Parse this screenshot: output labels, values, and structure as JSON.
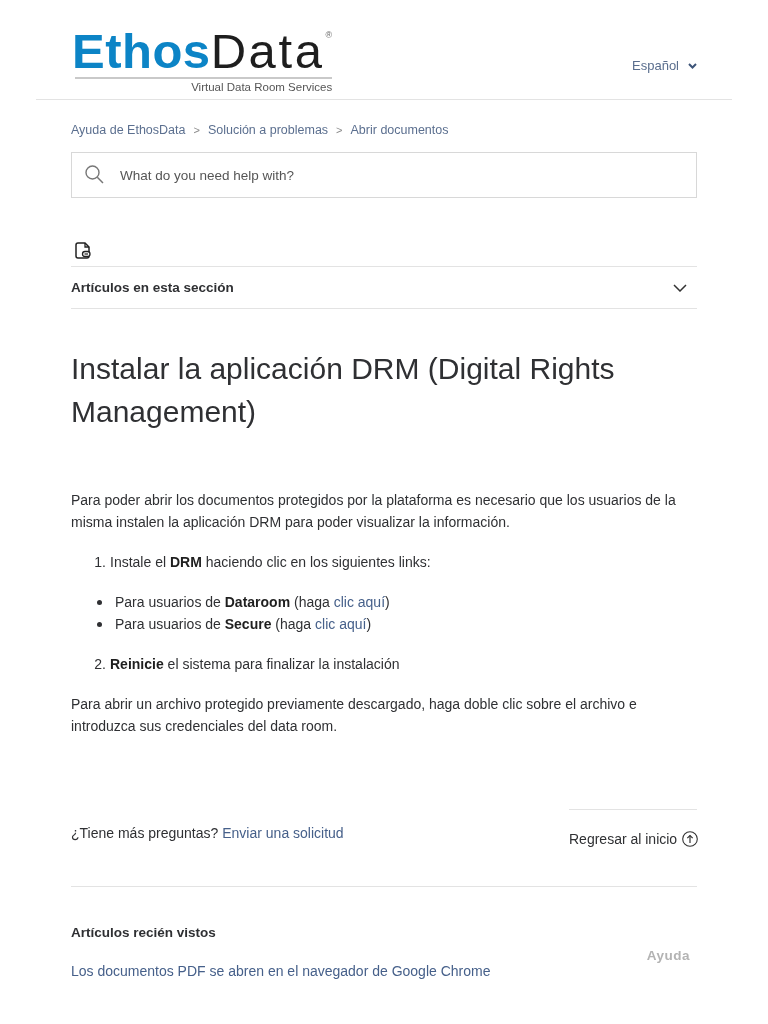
{
  "header": {
    "logo": {
      "name_part_1": "Ethos",
      "name_part_2": "Data",
      "registered_mark": "®",
      "tagline": "Virtual Data Room Services"
    },
    "language_selector": {
      "label": "Español"
    }
  },
  "breadcrumbs": [
    {
      "label": "Ayuda de EthosData",
      "separator": ">"
    },
    {
      "label": "Solución a problemas",
      "separator": ">"
    },
    {
      "label": "Abrir documentos"
    }
  ],
  "search": {
    "placeholder": "What do you need help with?"
  },
  "section_nav": {
    "label": "Artículos en esta sección",
    "expanded": false
  },
  "article": {
    "title": "Instalar la aplicación DRM (Digital Rights Management)",
    "blocks": [
      {
        "kind": "paragraph",
        "text": "Para poder abrir los documentos protegidos por la plataforma es necesario que los usuarios de la misma instalen la aplicación DRM para poder visualizar la información."
      },
      {
        "kind": "numbered",
        "number": "1.",
        "text": "Instale el **DRM** haciendo clic en los siguientes links:"
      },
      {
        "kind": "bullets",
        "items": [
          {
            "text": "Para usuarios de **Dataroom** (haga ",
            "link": "clic aquí",
            "text_after": ")"
          },
          {
            "text": "Para usuarios de **Secure** (haga ",
            "link": "clic aquí",
            "text_after": ")"
          }
        ]
      },
      {
        "kind": "numbered",
        "number": "2.",
        "text": "**Reinicie** el sistema para finalizar la instalación"
      },
      {
        "kind": "paragraph",
        "text": "Para abrir un archivo protegido previamente descargado, haga doble clic sobre el archivo e introduzca sus credenciales del data room."
      }
    ]
  },
  "footer": {
    "prompt": "¿Tiene más preguntas? ",
    "request_link": "Enviar una solicitud",
    "back_to_top": "Regresar al inicio"
  },
  "recently_viewed": {
    "heading": "Artículos recién vistos",
    "articles": [
      {
        "title": "Los documentos PDF se abren en el navegador de Google Chrome"
      }
    ],
    "side_label": "Ayuda"
  }
}
